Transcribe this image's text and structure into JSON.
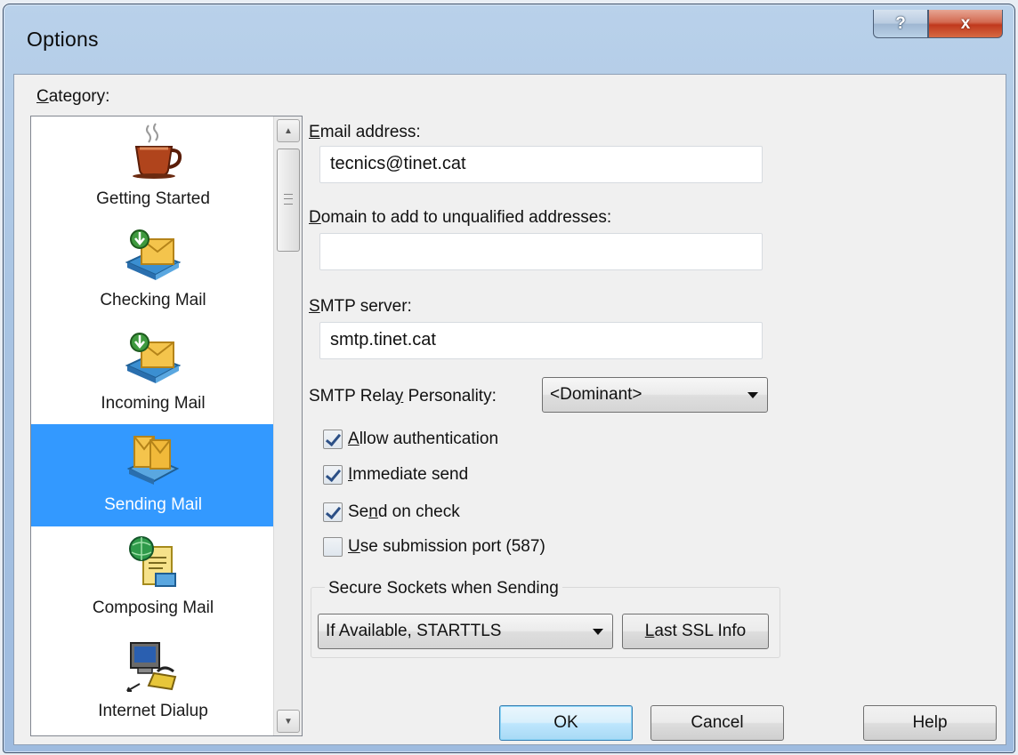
{
  "window": {
    "title": "Options",
    "help_glyph": "?",
    "close_glyph": "x"
  },
  "category": {
    "label_prefix": "C",
    "label_rest": "ategory:",
    "items": [
      {
        "label": "Getting Started",
        "icon": "coffee-cup-icon",
        "selected": false
      },
      {
        "label": "Checking Mail",
        "icon": "mail-check-icon",
        "selected": false
      },
      {
        "label": "Incoming Mail",
        "icon": "incoming-mail-icon",
        "selected": false
      },
      {
        "label": "Sending Mail",
        "icon": "sending-mail-icon",
        "selected": true
      },
      {
        "label": "Composing Mail",
        "icon": "composing-mail-icon",
        "selected": false
      },
      {
        "label": "Internet Dialup",
        "icon": "dialup-computer-icon",
        "selected": false
      }
    ]
  },
  "fields": {
    "email_label_u": "E",
    "email_label_rest": "mail address:",
    "email_value": "tecnics@tinet.cat",
    "domain_label_u": "D",
    "domain_label_rest": "omain to add to unqualified addresses:",
    "domain_value": "",
    "smtp_label_u": "S",
    "smtp_label_rest": "MTP server:",
    "smtp_value": "smtp.tinet.cat",
    "relay_label_pre": "SMTP Rela",
    "relay_label_u": "y",
    "relay_label_post": " Personality:",
    "relay_value": "<Dominant>"
  },
  "checkboxes": [
    {
      "u": "A",
      "rest": "llow authentication",
      "checked": true
    },
    {
      "u": "I",
      "rest": "mmediate send",
      "checked": true
    },
    {
      "pre": "Se",
      "u": "n",
      "rest": "d on check",
      "checked": true
    },
    {
      "u": "U",
      "rest": "se submission port (587)",
      "checked": false
    }
  ],
  "secure": {
    "group_title": "Secure Sockets when Sending",
    "select_value": "If Available, STARTTLS",
    "ssl_button_u": "L",
    "ssl_button_rest": "ast SSL Info"
  },
  "buttons": {
    "ok": "OK",
    "cancel": "Cancel",
    "help": "Help"
  },
  "colors": {
    "selection": "#3399ff",
    "default_button_border": "#3c7fb1",
    "close_button": "#c0391d"
  }
}
